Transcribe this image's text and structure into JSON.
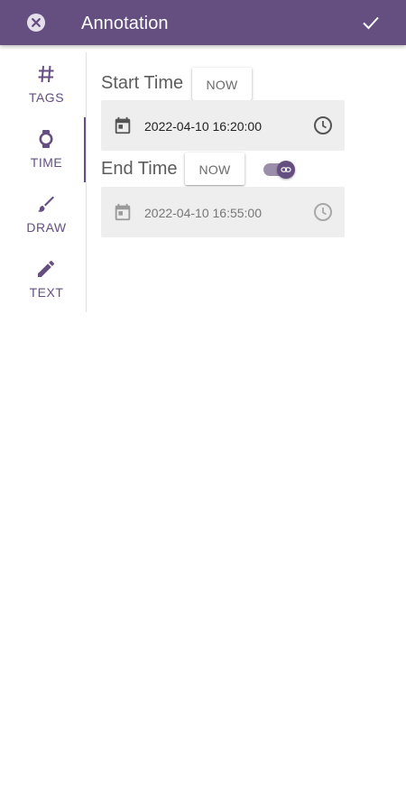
{
  "colors": {
    "primary": "#644f80",
    "field_bg": "#eeeeee",
    "text": "#5c5c5c"
  },
  "header": {
    "title": "Annotation",
    "close_icon": "close-circle-icon",
    "confirm_icon": "check-icon"
  },
  "sidebar": {
    "tabs": [
      {
        "label": "TAGS",
        "icon": "hash-icon",
        "active": false
      },
      {
        "label": "TIME",
        "icon": "watch-icon",
        "active": true
      },
      {
        "label": "DRAW",
        "icon": "brush-icon",
        "active": false
      },
      {
        "label": "TEXT",
        "icon": "pencil-icon",
        "active": false
      }
    ]
  },
  "start": {
    "label": "Start Time",
    "now_label": "NOW",
    "value": "2022-04-10 16:20:00"
  },
  "end": {
    "label": "End Time",
    "now_label": "NOW",
    "value": "2022-04-10 16:55:00",
    "link_toggle_on": true
  }
}
